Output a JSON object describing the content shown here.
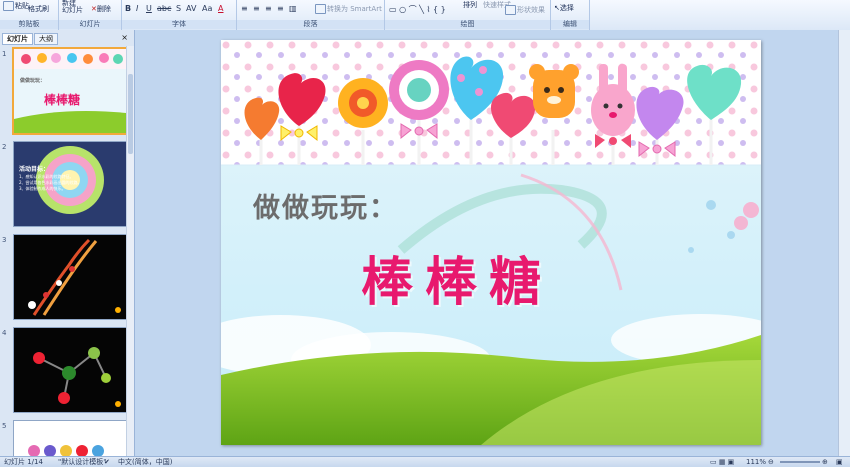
{
  "ribbon": {
    "clipboard": {
      "paste_label": "粘贴",
      "format_painter_label": "格式刷",
      "group_label": "剪贴板"
    },
    "slides": {
      "new_slide_label": "新建\n幻灯片",
      "delete_label": "删除",
      "group_label": "幻灯片"
    },
    "font": {
      "group_label": "字体"
    },
    "paragraph": {
      "convert_smartart_label": "转换为 SmartArt",
      "group_label": "段落"
    },
    "drawing": {
      "arrange_label": "排列",
      "quick_styles_label": "快速样式",
      "shape_effects_label": "形状效果",
      "group_label": "绘图"
    },
    "editing": {
      "select_label": "选择",
      "group_label": "编辑"
    }
  },
  "panel": {
    "tab_slides": "幻灯片",
    "tab_outline": "大纲",
    "close_glyph": "×",
    "thumbnails": [
      {
        "num": "1",
        "title_small": "做做玩玩：",
        "title_big": "棒棒糖"
      },
      {
        "num": "2",
        "heading": "活动目标：",
        "lines": [
          "1、感知认识水彩的纹路特征。",
          "2、尝试用各色水彩画出圆的纹路。",
          "3、体验制作成人的快乐。"
        ]
      },
      {
        "num": "3"
      },
      {
        "num": "4"
      },
      {
        "num": "5"
      }
    ]
  },
  "slide": {
    "subtitle": "做做玩玩：",
    "title": "棒棒糖"
  },
  "status": {
    "slide_count": "幻灯片 1/14",
    "theme": "\"默认设计模板\"",
    "language": "中文(简体，中国)",
    "zoom": "111%"
  },
  "colors": {
    "title_pink": "#e8196e",
    "subtitle_gray": "#6c6c6c",
    "grass_green": "#7dc11f",
    "sky_blue": "#cfeefa"
  }
}
